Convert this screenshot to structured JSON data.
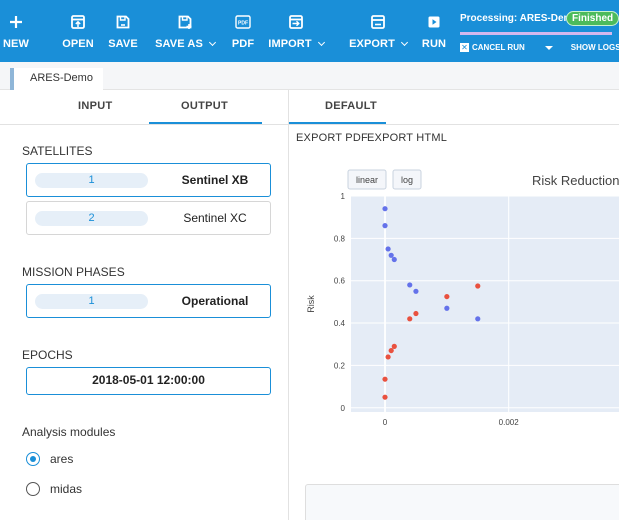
{
  "toolbar": {
    "buttons": [
      {
        "id": "new",
        "label": "NEW",
        "icon": "plus-icon"
      },
      {
        "id": "open",
        "label": "OPEN",
        "icon": "open-icon"
      },
      {
        "id": "save",
        "label": "SAVE",
        "icon": "save-icon"
      },
      {
        "id": "save_as",
        "label": "SAVE AS",
        "icon": "save-as-icon",
        "dropdown": true
      },
      {
        "id": "pdf",
        "label": "PDF",
        "icon": "pdf-icon",
        "icon_text": "PDF"
      },
      {
        "id": "import",
        "label": "IMPORT",
        "icon": "import-icon",
        "dropdown": true
      },
      {
        "id": "export",
        "label": "EXPORT",
        "icon": "export-icon",
        "dropdown": true
      },
      {
        "id": "run",
        "label": "RUN",
        "icon": "play-icon"
      }
    ],
    "processing": {
      "status_text": "Processing: ARES-Demo",
      "badge": "Finished",
      "cancel_label": "CANCEL RUN",
      "show_logs_label": "SHOW LOGS"
    }
  },
  "breadcrumb": {
    "project": "ARES-Demo"
  },
  "left": {
    "tabs": [
      {
        "label": "INPUT",
        "active": false
      },
      {
        "label": "OUTPUT",
        "active": true
      }
    ],
    "satellites_title": "SATELLITES",
    "satellites": [
      {
        "index": "1",
        "name": "Sentinel XB",
        "selected": true
      },
      {
        "index": "2",
        "name": "Sentinel XC",
        "selected": false
      }
    ],
    "phases_title": "MISSION PHASES",
    "phases": [
      {
        "index": "1",
        "name": "Operational",
        "selected": true
      }
    ],
    "epochs_title": "EPOCHS",
    "epoch_value": "2018-05-01 12:00:00",
    "modules_title": "Analysis modules",
    "modules": [
      {
        "label": "ares",
        "selected": true
      },
      {
        "label": "midas",
        "selected": false
      }
    ]
  },
  "right": {
    "tab": "DEFAULT",
    "export_pdf": "EXPORT PDF",
    "export_html": "EXPORT HTML",
    "scale_buttons": [
      "linear",
      "log"
    ]
  },
  "colors": {
    "accent": "#1a8fd8",
    "finished": "#4cbb5b",
    "series_blue": "#6472ea",
    "series_red": "#e9513f"
  },
  "chart_data": {
    "type": "scatter",
    "title": "Risk Reduction A",
    "xlabel": "",
    "ylabel": "Risk",
    "xlim": [
      -0.00055,
      0.0038
    ],
    "ylim": [
      -0.02,
      1.0
    ],
    "x_ticks": [
      0,
      0.002
    ],
    "x_tick_labels": [
      "0",
      "0.002"
    ],
    "y_ticks": [
      0,
      0.2,
      0.4,
      0.6,
      0.8,
      1
    ],
    "y_tick_labels": [
      "0",
      "0.2",
      "0.4",
      "0.6",
      "0.8",
      "1"
    ],
    "grid": true,
    "series": [
      {
        "color": "#6472ea",
        "points": [
          {
            "x": 0.0,
            "y": 0.94
          },
          {
            "x": 0.0,
            "y": 0.86
          },
          {
            "x": 5e-05,
            "y": 0.75
          },
          {
            "x": 0.0001,
            "y": 0.72
          },
          {
            "x": 0.00015,
            "y": 0.7
          },
          {
            "x": 0.0004,
            "y": 0.58
          },
          {
            "x": 0.0005,
            "y": 0.55
          },
          {
            "x": 0.001,
            "y": 0.47
          },
          {
            "x": 0.0015,
            "y": 0.42
          }
        ]
      },
      {
        "color": "#e9513f",
        "points": [
          {
            "x": 0.0,
            "y": 0.05
          },
          {
            "x": 0.0,
            "y": 0.135
          },
          {
            "x": 5e-05,
            "y": 0.24
          },
          {
            "x": 0.0001,
            "y": 0.27
          },
          {
            "x": 0.00015,
            "y": 0.29
          },
          {
            "x": 0.0004,
            "y": 0.42
          },
          {
            "x": 0.0005,
            "y": 0.445
          },
          {
            "x": 0.001,
            "y": 0.525
          },
          {
            "x": 0.0015,
            "y": 0.575
          }
        ]
      }
    ]
  }
}
